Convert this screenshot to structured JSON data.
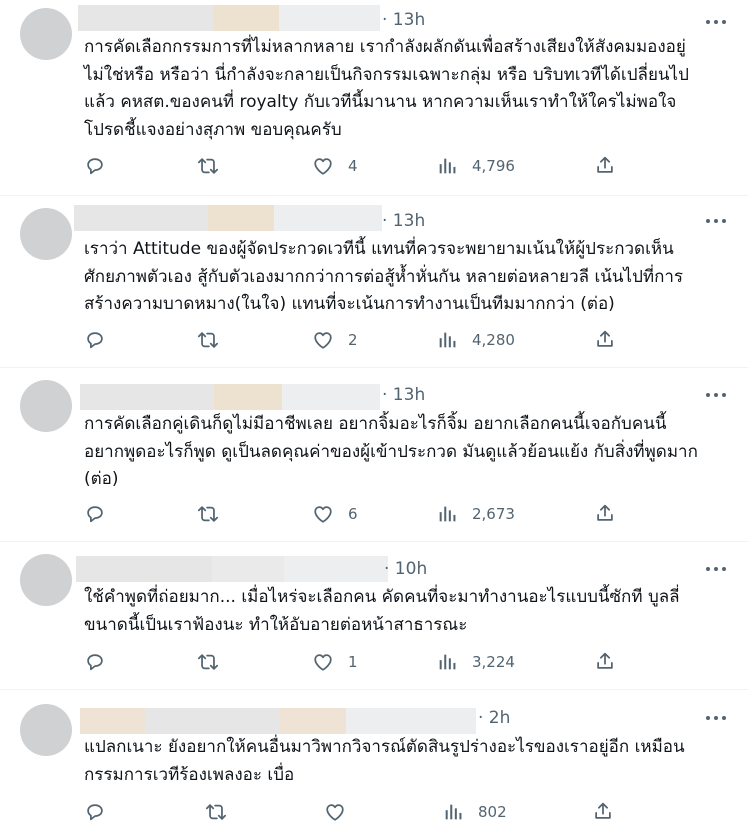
{
  "icons": {
    "reply": "reply-icon",
    "repost": "repost-icon",
    "like": "like-icon",
    "views": "views-icon",
    "share": "share-icon",
    "more": "more-icon"
  },
  "colors": {
    "text": "#0f1419",
    "secondary": "#536471",
    "divider": "#eff3f4",
    "avatar_placeholder": "#cfd1d3"
  },
  "posts": [
    {
      "time": "· 13h",
      "text": "การคัดเลือกกรรมการที่ไม่หลากหลาย เรากำลังผลักดันเพื่อสร้างเสียงให้สังคมมองอยู่\nไม่ใช่หรือ หรือว่า นี่กำลังจะกลายเป็นกิจกรรมเฉพาะกลุ่ม หรือ บริบทเวทีได้เปลี่ยนไป\nแล้ว คหสต.ของคนที่ royalty กับเวทีนี้มานาน หากความเห็นเราทำให้ใครไม่พอใจ\nโปรดชี้แจงอย่างสุภาพ ขอบคุณครับ",
      "likes": "4",
      "views": "4,796"
    },
    {
      "time": "· 13h",
      "text": "เราว่า Attitude ของผู้จัดประกวดเวทีนี้ แทนที่ควรจะพยายามเน้นให้ผู้ประกวดเห็น\nศักยภาพตัวเอง สู้กับตัวเองมากกว่าการต่อสู้ห้ำหั่นกัน หลายต่อหลายวลี เน้นไปที่การ\nสร้างความบาดหมาง(ในใจ) แทนที่จะเน้นการทำงานเป็นทีมมากกว่า (ต่อ)",
      "likes": "2",
      "views": "4,280"
    },
    {
      "time": "· 13h",
      "text": "การคัดเลือกคู่เดินก็ดูไม่มีอาชีพเลย อยากจิ้มอะไรก็จิ้ม อยากเลือกคนนี้เจอกับคนนี้\nอยากพูดอะไรก็พูด ดูเป็นลดคุณค่าของผู้เข้าประกวด มันดูแล้วย้อนแย้ง กับสิ่งที่พูดมาก\n(ต่อ)",
      "likes": "6",
      "views": "2,673"
    },
    {
      "time": "· 10h",
      "text": "ใช้คำพูดที่ถ่อยมาก... เมื่อไหร่จะเลือกคน คัดคนที่จะมาทำงานอะไรแบบนี้ซักที บูลลี่\nขนาดนี้เป็นเราฟ้องนะ ทำให้อับอายต่อหน้าสาธารณะ",
      "likes": "1",
      "views": "3,224"
    },
    {
      "time": "· 2h",
      "text": "แปลกเนาะ ยังอยากให้คนอื่นมาวิพากวิจารณ์ตัดสินรูปร่างอะไรของเราอยู่อีก เหมือน\nกรรมการเวทีร้องเพลงอะ เบื่อ",
      "likes": "",
      "views": "802"
    }
  ]
}
